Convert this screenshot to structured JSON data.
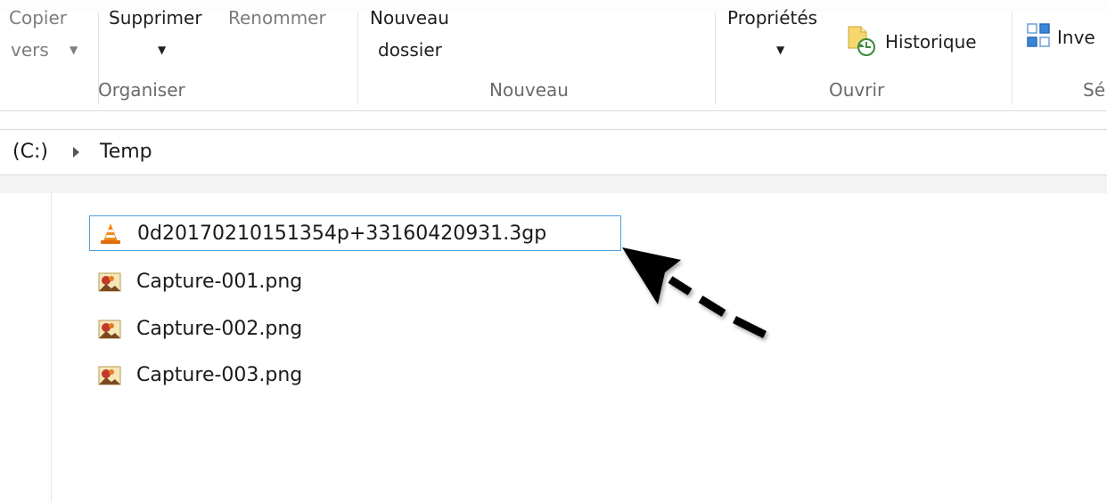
{
  "ribbon": {
    "organiser": {
      "copier_line1": "Copier",
      "copier_line2": "vers",
      "supprimer": "Supprimer",
      "renommer": "Renommer",
      "label": "Organiser"
    },
    "nouveau": {
      "nouveau_dossier_line1": "Nouveau",
      "nouveau_dossier_line2": "dossier",
      "label": "Nouveau"
    },
    "ouvrir": {
      "proprietes": "Propriétés",
      "historique": "Historique",
      "label": "Ouvrir"
    },
    "selectionner": {
      "inverser": "Inve",
      "label": "Sé"
    }
  },
  "address": {
    "drive": "(C:)",
    "folder": "Temp"
  },
  "files": [
    {
      "name": "0d20170210151354p+33160420931.3gp",
      "icon": "vlc-cone-icon",
      "selected": true
    },
    {
      "name": "Capture-001.png",
      "icon": "png-image-icon",
      "selected": false
    },
    {
      "name": "Capture-002.png",
      "icon": "png-image-icon",
      "selected": false
    },
    {
      "name": "Capture-003.png",
      "icon": "png-image-icon",
      "selected": false
    }
  ],
  "colors": {
    "selection_border": "#4ea1e0",
    "vlc_orange": "#f08a1c",
    "annotation_arrow": "#000000"
  }
}
